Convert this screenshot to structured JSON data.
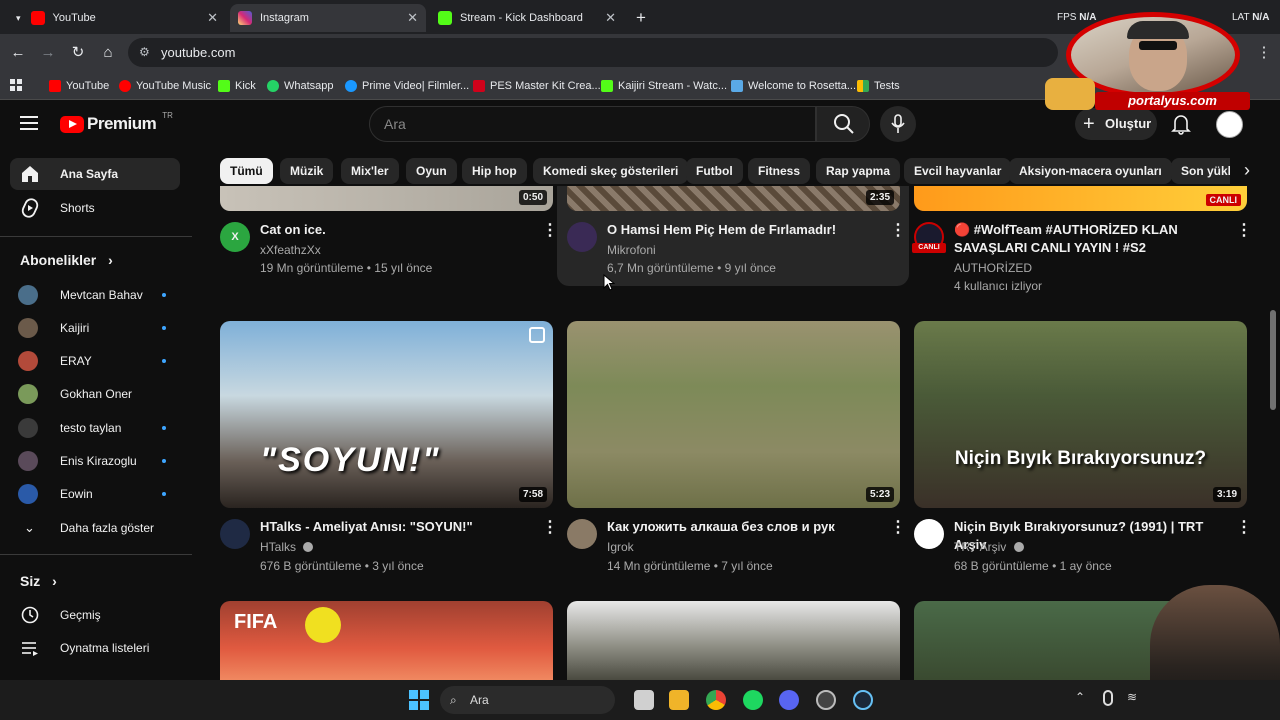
{
  "browser": {
    "tabs": [
      {
        "label": "YouTube",
        "active": false
      },
      {
        "label": "Instagram",
        "active": true
      },
      {
        "label": "Stream - Kick Dashboard",
        "active": false
      }
    ],
    "url": "youtube.com",
    "stats": {
      "fps_label": "FPS",
      "fps_value": "N/A",
      "lat_label": "LAT",
      "lat_value": "N/A"
    },
    "bookmarks": [
      "YouTube",
      "YouTube Music",
      "Kick",
      "Whatsapp",
      "Prime Video| Filmler...",
      "PES Master Kit Crea...",
      "Kaijiri Stream - Watc...",
      "Welcome to Rosetta...",
      "Tests"
    ]
  },
  "overlay": {
    "brand": "portalyus.com"
  },
  "youtube": {
    "logo": "Premium",
    "region": "TR",
    "search_placeholder": "Ara",
    "create_label": "Oluştur",
    "chips": [
      "Tümü",
      "Müzik",
      "Mix'ler",
      "Oyun",
      "Hip hop",
      "Komedi skeç gösterileri",
      "Futbol",
      "Fitness",
      "Rap yapma",
      "Evcil hayvanlar",
      "Aksiyon-macera oyunları",
      "Son yükle"
    ],
    "sidebar": {
      "home": "Ana Sayfa",
      "shorts": "Shorts",
      "subs_header": "Abonelikler",
      "subs": [
        "Mevtcan Bahav",
        "Kaijiri",
        "ERAY",
        "Gokhan Oner",
        "testo taylan",
        "Enis Kirazoglu",
        "Eowin"
      ],
      "show_more": "Daha fazla göster",
      "you_header": "Siz",
      "history": "Geçmiş",
      "playlists": "Oynatma listeleri"
    },
    "videos": [
      {
        "title": "Cat on ice.",
        "channel": "xXfeathzXx",
        "meta": "19 Mn görüntüleme • 15 yıl önce",
        "duration": "0:50",
        "avatar_letter": "X",
        "avatar_color": "#2ba640"
      },
      {
        "title": "O Hamsi Hem Piç Hem de Fırlamadır!",
        "channel": "Mikrofoni",
        "meta": "6,7 Mn görüntüleme • 9 yıl önce",
        "duration": "2:35",
        "avatar_color": "#3a2a55"
      },
      {
        "title": "🔴 #WolfTeam #AUTHORİZED KLAN SAVAŞLARI CANLI YAYIN ! #S2",
        "channel": "AUTHORİZED",
        "meta": "4 kullanıcı izliyor",
        "badge": "CANLI",
        "avatar_color": "#1a1a2e"
      },
      {
        "title": "HTalks - Ameliyat Anısı: \"SOYUN!\"",
        "channel": "HTalks",
        "meta": "676 B görüntüleme • 3 yıl önce",
        "duration": "7:58",
        "overlay": "\"SOYUN!\"",
        "avatar_color": "#1f2a44"
      },
      {
        "title": "Как уложить алкаша без слов и рук",
        "channel": "Igrok",
        "meta": "14 Mn görüntüleme • 7 yıl önce",
        "duration": "5:23",
        "avatar_color": "#8a7a66"
      },
      {
        "title": "Niçin Bıyık Bırakıyorsunuz? (1991) | TRT Arşiv",
        "channel": "TRT Arşiv",
        "meta": "68 B görüntüleme • 1 ay önce",
        "duration": "3:19",
        "overlay": "Niçin Bıyık Bırakıyorsunuz?",
        "avatar_color": "#ffffff"
      },
      {
        "overlay": "FIFA"
      }
    ]
  },
  "taskbar": {
    "search": "Ara"
  }
}
